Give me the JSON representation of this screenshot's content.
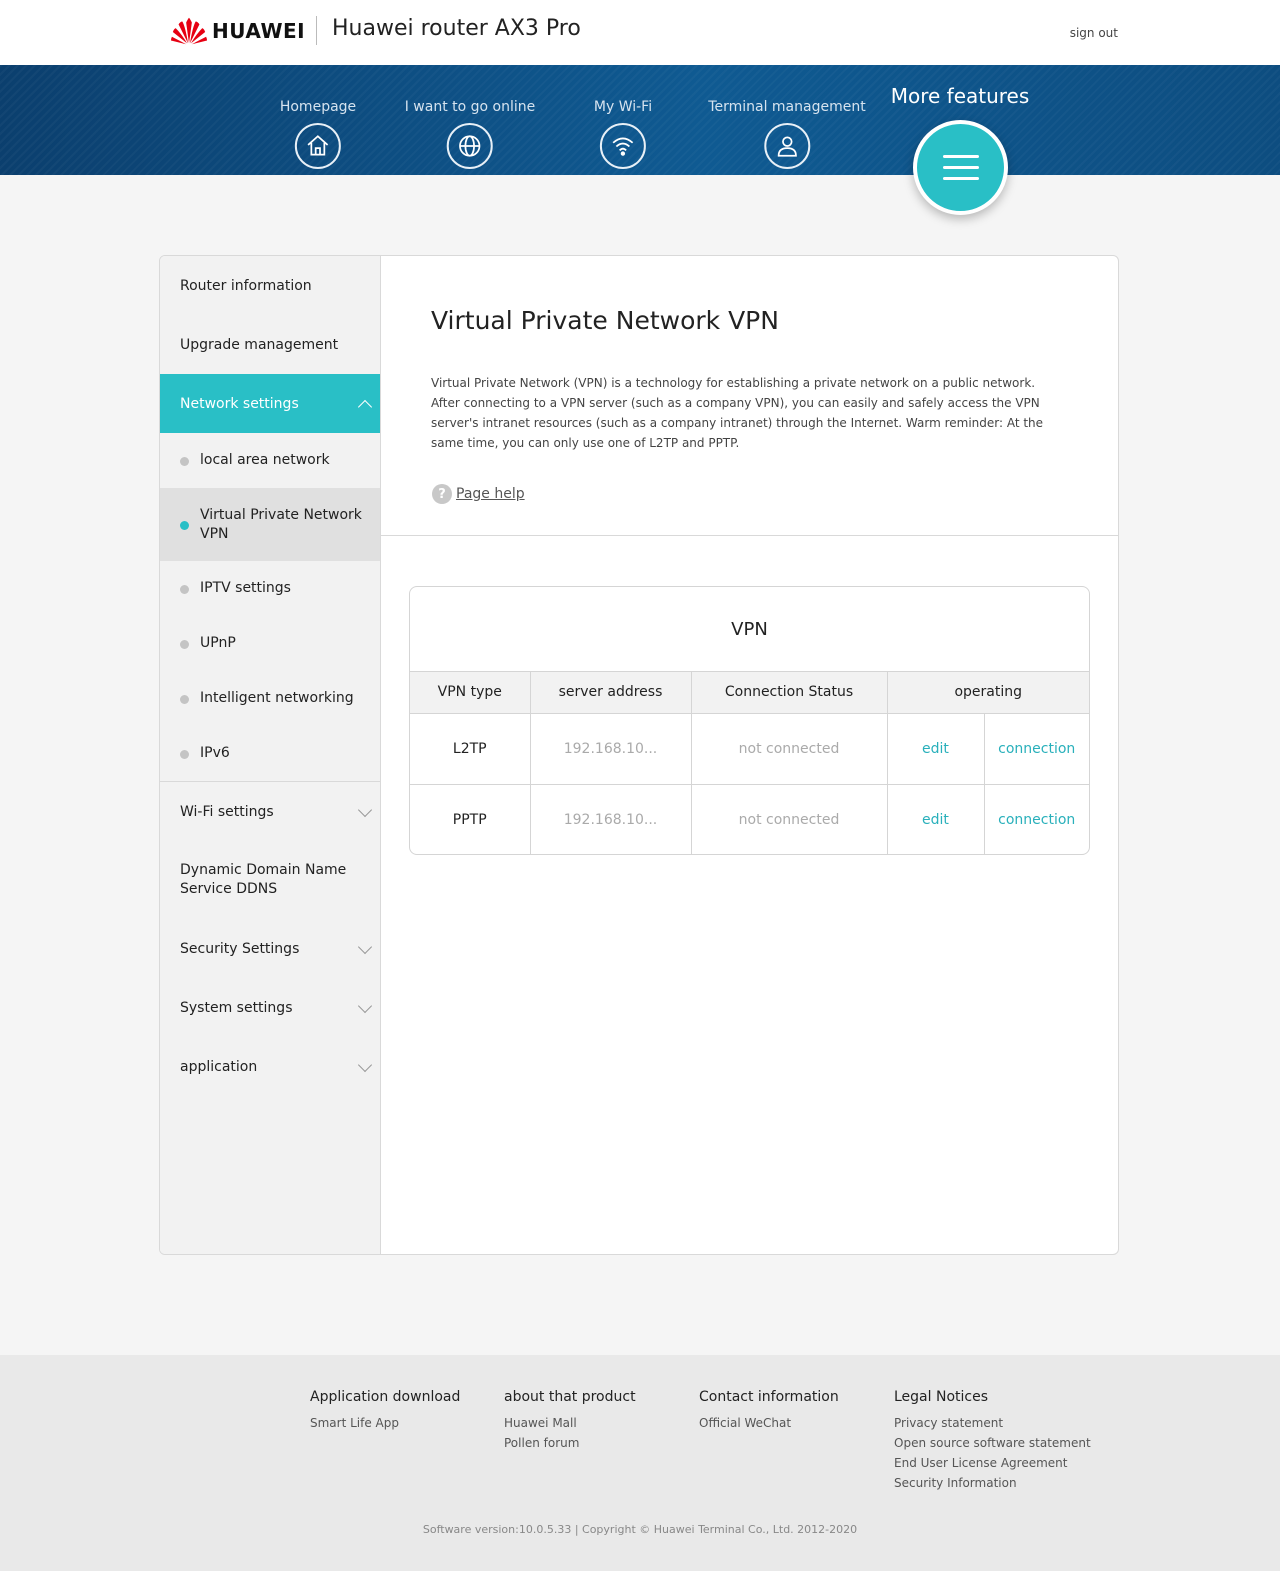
{
  "header": {
    "brand": "HUAWEI",
    "product_title": "Huawei router AX3 Pro",
    "sign_out": "sign out"
  },
  "nav": {
    "items": [
      {
        "label": "Homepage",
        "icon": "home-icon"
      },
      {
        "label": "I want to go online",
        "icon": "globe-icon"
      },
      {
        "label": "My Wi-Fi",
        "icon": "wifi-icon"
      },
      {
        "label": "Terminal management",
        "icon": "user-icon"
      }
    ],
    "more_label": "More features",
    "more_icon": "menu-icon"
  },
  "sidebar": {
    "top_items": [
      {
        "label": "Router information"
      },
      {
        "label": "Upgrade management"
      }
    ],
    "active_group": {
      "label": "Network settings",
      "expanded": true
    },
    "sub_items": [
      {
        "label": "local area network"
      },
      {
        "label": "Virtual Private Network VPN",
        "current": true
      },
      {
        "label": "IPTV settings"
      },
      {
        "label": "UPnP"
      },
      {
        "label": "Intelligent networking"
      },
      {
        "label": "IPv6"
      }
    ],
    "bottom_items": [
      {
        "label": "Wi-Fi settings",
        "expandable": true
      },
      {
        "label": "Dynamic Domain Name Service DDNS",
        "expandable": false
      },
      {
        "label": "Security Settings",
        "expandable": true
      },
      {
        "label": "System settings",
        "expandable": true
      },
      {
        "label": "application",
        "expandable": true
      }
    ]
  },
  "main": {
    "title": "Virtual Private Network VPN",
    "description": "Virtual Private Network (VPN) is a technology for establishing a private network on a public network. After connecting to a VPN server (such as a company VPN), you can easily and safely access the VPN server's intranet resources (such as a company intranet) through the Internet. Warm reminder: At the same time, you can only use one of L2TP and PPTP.",
    "help_label": "Page help",
    "vpn_table": {
      "title": "VPN",
      "headers": [
        "VPN type",
        "server address",
        "Connection Status",
        "operating"
      ],
      "rows": [
        {
          "type": "L2TP",
          "server": "192.168.10...",
          "status": "not connected",
          "edit": "edit",
          "connect": "connection"
        },
        {
          "type": "PPTP",
          "server": "192.168.10...",
          "status": "not connected",
          "edit": "edit",
          "connect": "connection"
        }
      ]
    }
  },
  "footer": {
    "columns": [
      {
        "title": "Application download",
        "links": [
          "Smart Life App"
        ]
      },
      {
        "title": "about that product",
        "links": [
          "Huawei Mall",
          "Pollen forum"
        ]
      },
      {
        "title": "Contact information",
        "links": [
          "Official WeChat"
        ]
      },
      {
        "title": "Legal Notices",
        "links": [
          "Privacy statement",
          "Open source software statement",
          "End User License Agreement",
          "Security Information"
        ]
      }
    ],
    "copyright": "Software version:10.0.5.33 |  Copyright © Huawei Terminal Co., Ltd. 2012-2020"
  },
  "colors": {
    "accent": "#29bfc6",
    "nav_band": "#0f5a92",
    "brand_red": "#e60012"
  }
}
